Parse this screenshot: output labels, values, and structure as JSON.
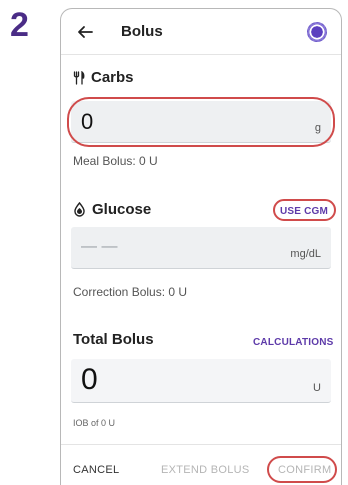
{
  "step": {
    "number": "2"
  },
  "header": {
    "title": "Bolus",
    "back_icon": "arrow-left-icon",
    "status_icon": "pump-status-icon"
  },
  "carbs": {
    "label": "Carbs",
    "icon": "fork-knife-icon",
    "value": "0",
    "unit": "g",
    "meal_bolus": "Meal Bolus: 0 U"
  },
  "glucose": {
    "label": "Glucose",
    "icon": "blood-drop-icon",
    "use_cgm": "USE CGM",
    "value": "— —",
    "unit": "mg/dL",
    "correction_bolus": "Correction Bolus: 0 U"
  },
  "total": {
    "label": "Total Bolus",
    "calculations": "CALCULATIONS",
    "value": "0",
    "unit": "U",
    "iob": "IOB of 0 U"
  },
  "footer": {
    "cancel": "CANCEL",
    "extend": "EXTEND BOLUS",
    "confirm": "CONFIRM"
  },
  "colors": {
    "accent": "#5d3aa9",
    "callout": "#d04b4b",
    "step": "#4a2c86",
    "field_bg": "#eef0f2"
  }
}
